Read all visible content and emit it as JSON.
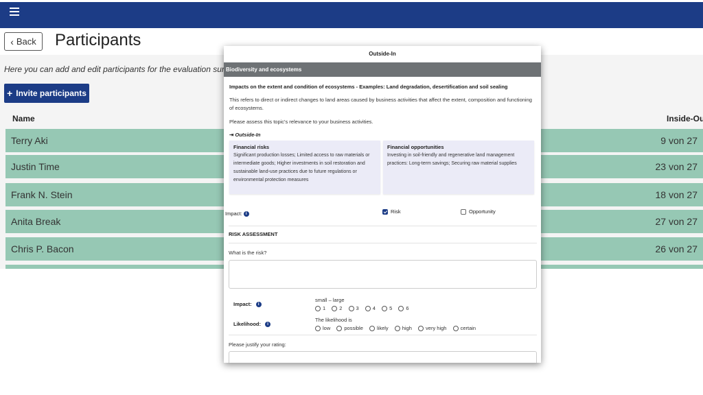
{
  "header": {
    "menu_icon": "hamburger-menu-icon",
    "back_label": "Back",
    "title": "Participants"
  },
  "intro_text": "Here you can add and edit participants for the evaluation surve",
  "invite_label": "Invite participants",
  "table": {
    "columns": [
      "Name",
      "Inside-Ou"
    ],
    "rows": [
      {
        "name": "Terry Aki",
        "score": "9 von 27"
      },
      {
        "name": "Justin Time",
        "score": "23 von 27"
      },
      {
        "name": "Frank N. Stein",
        "score": "18 von 27"
      },
      {
        "name": "Anita Break",
        "score": "27 von 27"
      },
      {
        "name": "Chris P. Bacon",
        "score": "26 von 27"
      }
    ]
  },
  "dialog": {
    "title": "Outside-In",
    "section": "Biodiversity and ecosystems",
    "topic_heading": "Impacts on the extent and condition of ecosystems - Examples: Land degradation, desertification and soil sealing",
    "topic_desc": "This refers to direct or indirect changes to land areas caused by business activities that affect the extent, composition and functioning of ecosystems.",
    "assess_text": "Please assess this topic's relevance to your business activities.",
    "outside_in_label": "Outside-In",
    "risk_card": {
      "title": "Financial risks",
      "body": "Significant production losses; Limited access to raw materials or intermediate goods; Higher investments in soil restoration and sustainable land-use practices due to future regulations or environmental protection measures"
    },
    "opp_card": {
      "title": "Financial opportunities",
      "body": "Investing in soil-friendly and regenerative land management practices: Long-term savings; Securing raw material supplies"
    },
    "impact_label": "Impact:",
    "risk_label": "Risk",
    "risk_checked": true,
    "opportunity_label": "Opportunity",
    "opportunity_checked": false,
    "risk_assessment_heading": "RISK ASSESSMENT",
    "what_risk_label": "What is the risk?",
    "impact_scale_label": "Impact:",
    "impact_scale_hint": "small – large",
    "impact_options": [
      "1",
      "2",
      "3",
      "4",
      "5",
      "6"
    ],
    "likelihood_label": "Likelihood:",
    "likelihood_hint": "The likelihood is",
    "likelihood_options": [
      "low",
      "possible",
      "likely",
      "high",
      "very high",
      "certain"
    ],
    "justify_label": "Please justify your rating:"
  }
}
